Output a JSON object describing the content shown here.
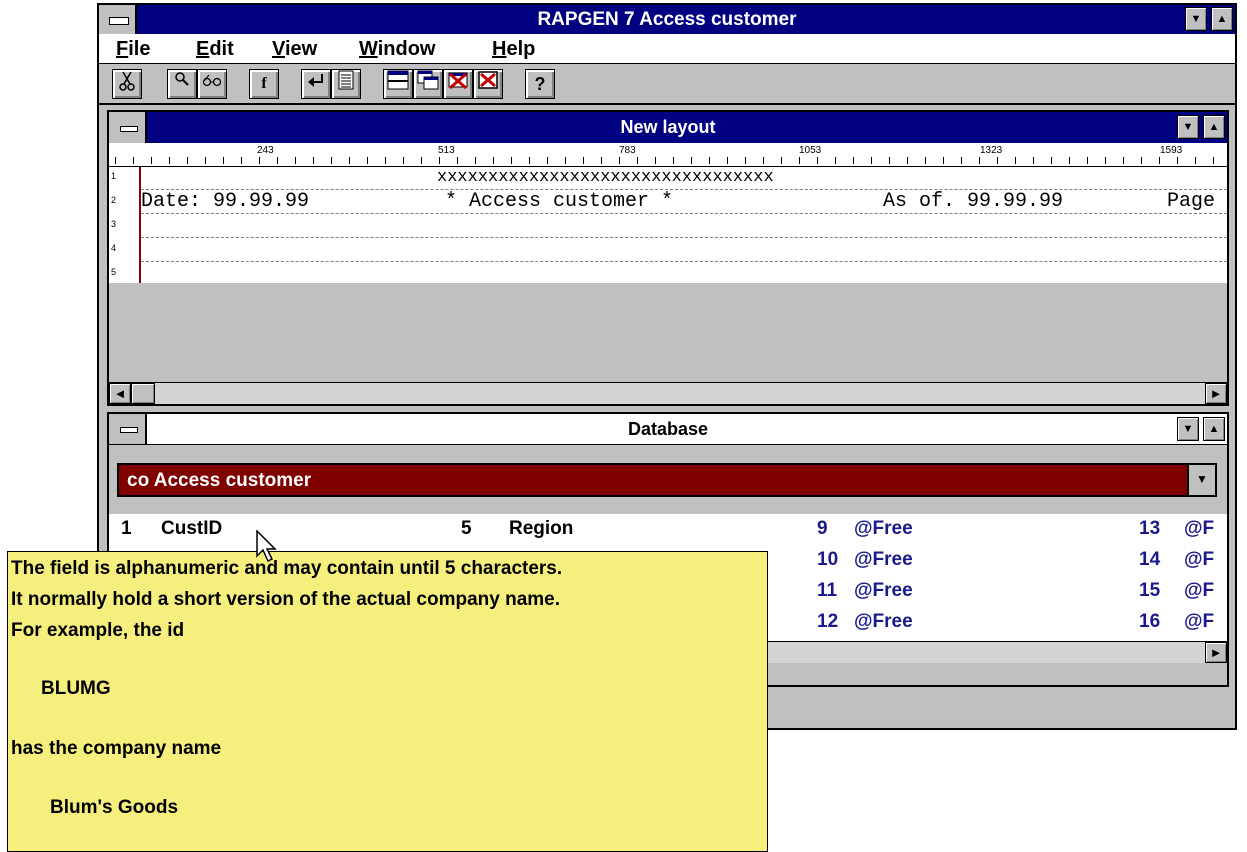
{
  "app": {
    "title": "RAPGEN 7 Access customer",
    "menu": [
      "File",
      "Edit",
      "View",
      "Window",
      "Help"
    ],
    "toolbar_icons": [
      "scissors-icon",
      "search-icon",
      "glasses-icon",
      "function-icon",
      "enter-icon",
      "text-lines-icon",
      "split-window-icon",
      "cascade-window-icon",
      "print-delete-icon",
      "close-window-icon",
      "help-icon"
    ],
    "toolbar_glyphs": {
      "function": "f",
      "help": "?"
    }
  },
  "layout_window": {
    "title": "New layout",
    "ruler_numbers": [
      "243",
      "513",
      "783",
      "1053",
      "1323",
      "1593"
    ],
    "line_numbers": [
      "1",
      "2",
      "3",
      "4",
      "5"
    ],
    "line1": "xxxxxxxxxxxxxxxxxxxxxxxxxxxxxxxxx",
    "line2_date": "Date: 99.99.99",
    "line2_title": "* Access customer *",
    "line2_asof": "As of. 99.99.99",
    "line2_page": "Page"
  },
  "database_window": {
    "title": "Database",
    "selector_text": "co   Access customer",
    "fields": [
      {
        "num": "1",
        "name": "CustID"
      },
      {
        "num": "5",
        "name": "Region"
      },
      {
        "num": "9",
        "name": "@Free"
      },
      {
        "num": "10",
        "name": "@Free"
      },
      {
        "num": "11",
        "name": "@Free"
      },
      {
        "num": "12",
        "name": "@Free"
      },
      {
        "num": "13",
        "name": "@F"
      },
      {
        "num": "14",
        "name": "@F"
      },
      {
        "num": "15",
        "name": "@F"
      },
      {
        "num": "16",
        "name": "@F"
      }
    ]
  },
  "tooltip": {
    "lines": [
      "The field is alphanumeric and may contain until 5 characters.",
      "It normally hold a short version of the actual company name.",
      "For example, the id",
      "BLUMG",
      "has the company name",
      "Blum's Goods"
    ]
  },
  "colors": {
    "title_bar": "#000080",
    "selector_bg": "#800000",
    "tooltip_bg": "#f6ef7e",
    "field_blue": "#1a1a8c"
  }
}
